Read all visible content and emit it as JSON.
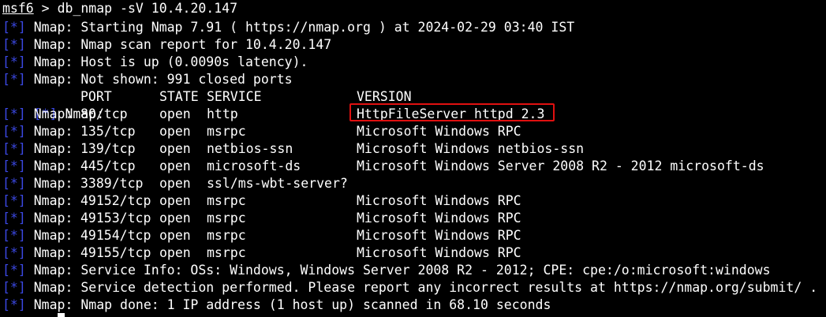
{
  "prompt": {
    "name": "msf6",
    "symbol": " > ",
    "command": "db_nmap -sV 10.4.20.147"
  },
  "tag": "[*]",
  "lines": [
    {
      "text": " Nmap: Starting Nmap 7.91 ( https://nmap.org ) at 2024-02-29 03:40 IST"
    },
    {
      "text": " Nmap: Nmap scan report for 10.4.20.147"
    },
    {
      "text": " Nmap: Host is up (0.0090s latency)."
    },
    {
      "text": " Nmap: Not shown: 991 closed ports"
    }
  ],
  "table": {
    "prefix": " Nmap: ",
    "headers": {
      "port": "PORT",
      "state": "STATE",
      "service": "SERVICE",
      "version": "VERSION"
    },
    "rows": [
      {
        "port": "80/tcp",
        "state": "open",
        "service": "http",
        "version": "HttpFileServer httpd 2.3"
      },
      {
        "port": "135/tcp",
        "state": "open",
        "service": "msrpc",
        "version": "Microsoft Windows RPC"
      },
      {
        "port": "139/tcp",
        "state": "open",
        "service": "netbios-ssn",
        "version": "Microsoft Windows netbios-ssn"
      },
      {
        "port": "445/tcp",
        "state": "open",
        "service": "microsoft-ds",
        "version": "Microsoft Windows Server 2008 R2 - 2012 microsoft-ds"
      },
      {
        "port": "3389/tcp",
        "state": "open",
        "service": "ssl/ms-wbt-server?",
        "version": ""
      },
      {
        "port": "49152/tcp",
        "state": "open",
        "service": "msrpc",
        "version": "Microsoft Windows RPC"
      },
      {
        "port": "49153/tcp",
        "state": "open",
        "service": "msrpc",
        "version": "Microsoft Windows RPC"
      },
      {
        "port": "49154/tcp",
        "state": "open",
        "service": "msrpc",
        "version": "Microsoft Windows RPC"
      },
      {
        "port": "49155/tcp",
        "state": "open",
        "service": "msrpc",
        "version": "Microsoft Windows RPC"
      }
    ]
  },
  "footer_lines": [
    {
      "text": " Nmap: Service Info: OSs: Windows, Windows Server 2008 R2 - 2012; CPE: cpe:/o:microsoft:windows"
    },
    {
      "text": " Nmap: Service detection performed. Please report any incorrect results at https://nmap.org/submit/ ."
    },
    {
      "text": " Nmap: Nmap done: 1 IP address (1 host up) scanned in 68.10 seconds"
    }
  ],
  "colors": {
    "background": "#000000",
    "text": "#ffffff",
    "tag": "#3b48e3",
    "highlight": "#e01010"
  }
}
